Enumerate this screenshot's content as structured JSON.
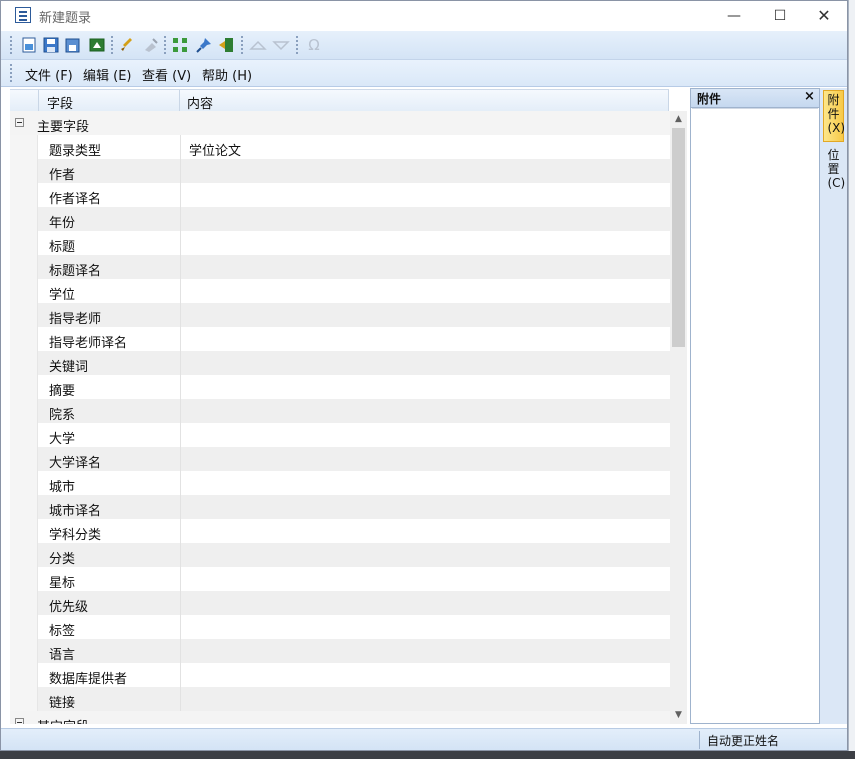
{
  "window": {
    "title": "新建题录",
    "minimize_glyph": "—",
    "maximize_glyph": "☐",
    "close_glyph": "✕"
  },
  "toolbar": {
    "icons": [
      "new-document-icon",
      "save-icon",
      "save-all-icon",
      "export-icon",
      "brush-icon",
      "clear-icon",
      "grid-icon",
      "pin-icon",
      "import-icon",
      "move-up-icon",
      "move-down-icon",
      "omega-icon"
    ],
    "omega_glyph": "Ω"
  },
  "menu": {
    "items": [
      "文件 (F)",
      "编辑 (E)",
      "查看 (V)",
      "帮助 (H)"
    ]
  },
  "grid": {
    "header_field": "字段",
    "header_value": "内容",
    "group_main": "主要字段",
    "group_other": "其它字段",
    "rows": [
      {
        "field": "题录类型",
        "value": "学位论文"
      },
      {
        "field": "作者",
        "value": ""
      },
      {
        "field": "作者译名",
        "value": ""
      },
      {
        "field": "年份",
        "value": ""
      },
      {
        "field": "标题",
        "value": ""
      },
      {
        "field": "标题译名",
        "value": ""
      },
      {
        "field": "学位",
        "value": ""
      },
      {
        "field": "指导老师",
        "value": ""
      },
      {
        "field": "指导老师译名",
        "value": ""
      },
      {
        "field": "关键词",
        "value": ""
      },
      {
        "field": "摘要",
        "value": ""
      },
      {
        "field": "院系",
        "value": ""
      },
      {
        "field": "大学",
        "value": ""
      },
      {
        "field": "大学译名",
        "value": ""
      },
      {
        "field": "城市",
        "value": ""
      },
      {
        "field": "城市译名",
        "value": ""
      },
      {
        "field": "学科分类",
        "value": ""
      },
      {
        "field": "分类",
        "value": ""
      },
      {
        "field": "星标",
        "value": ""
      },
      {
        "field": "优先级",
        "value": ""
      },
      {
        "field": "标签",
        "value": ""
      },
      {
        "field": "语言",
        "value": ""
      },
      {
        "field": "数据库提供者",
        "value": ""
      },
      {
        "field": "链接",
        "value": ""
      }
    ]
  },
  "attachments": {
    "title": "附件",
    "close_glyph": "×"
  },
  "side_tabs": {
    "attach": "附件(X)",
    "position": "位置(C)"
  },
  "status": {
    "text": "自动更正姓名"
  },
  "colors": {
    "accent": "#2d5b9a",
    "toolbar_bg": "#dae8f8",
    "row_alt": "#efefef",
    "tab_active": "#f7c948"
  }
}
